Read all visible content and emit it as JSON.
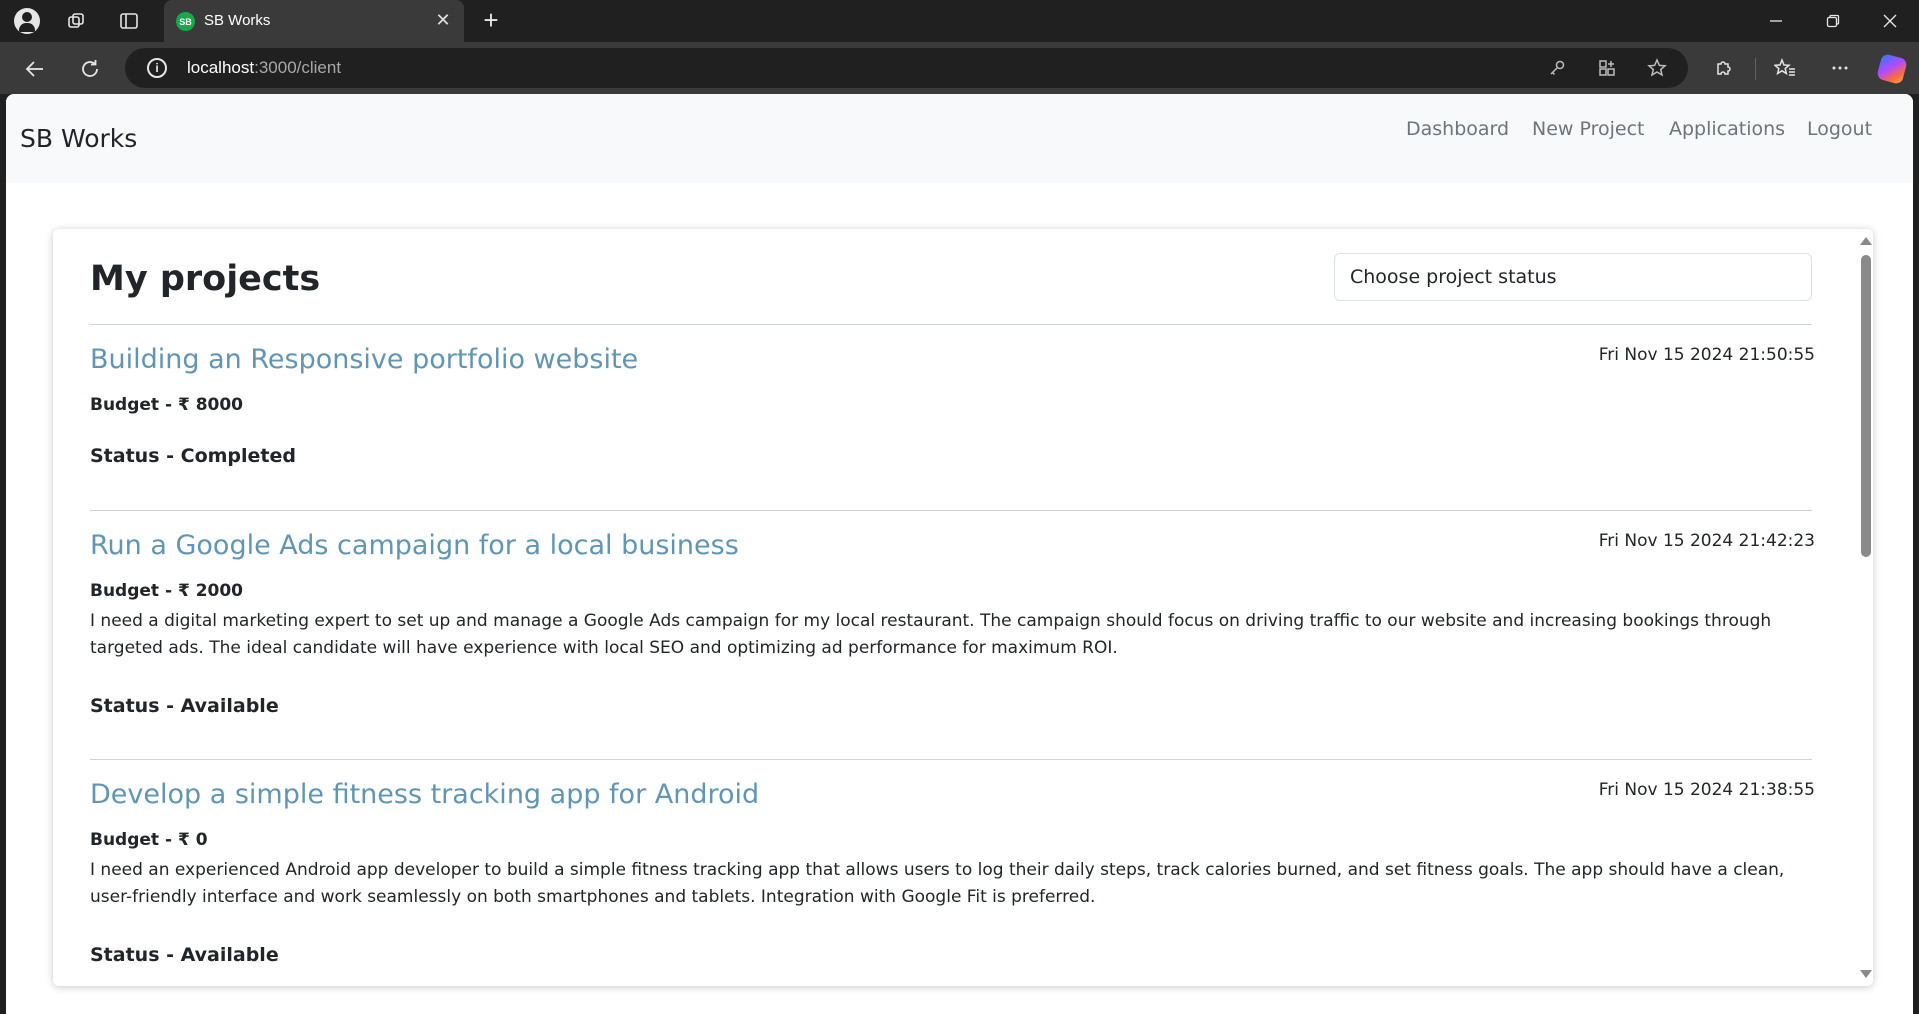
{
  "browser": {
    "tab_title": "SB Works",
    "tab_favicon_text": "SB",
    "url_host": "localhost",
    "url_path": ":3000/client",
    "icons": [
      "profile-icon",
      "workspaces-icon",
      "vertical-tabs-icon",
      "close-icon",
      "new-tab-icon",
      "minimize-icon",
      "maximize-icon",
      "window-close-icon",
      "back-icon",
      "refresh-icon",
      "site-info-icon",
      "password-key-icon",
      "app-available-icon",
      "favorite-star-icon",
      "extensions-icon",
      "favorites-icon",
      "more-icon",
      "copilot-icon"
    ]
  },
  "site": {
    "brand": "SB Works",
    "nav": {
      "dashboard": "Dashboard",
      "new_project": "New Project",
      "applications": "Applications",
      "logout": "Logout"
    }
  },
  "main": {
    "title": "My projects",
    "status_select_placeholder": "Choose project status",
    "projects": [
      {
        "title": "Building an Responsive portfolio website",
        "time": "Fri Nov 15 2024 21:50:55",
        "budget": "Budget - ₹ 8000",
        "description": "",
        "status": "Status - Completed"
      },
      {
        "title": "Run a Google Ads campaign for a local business",
        "time": "Fri Nov 15 2024 21:42:23",
        "budget": "Budget - ₹ 2000",
        "description": "I need a digital marketing expert to set up and manage a Google Ads campaign for my local restaurant. The campaign should focus on driving traffic to our website and increasing bookings through targeted ads. The ideal candidate will have experience with local SEO and optimizing ad performance for maximum ROI.",
        "status": "Status - Available"
      },
      {
        "title": "Develop a simple fitness tracking app for Android",
        "time": "Fri Nov 15 2024 21:38:55",
        "budget": "Budget - ₹ 0",
        "description": "I need an experienced Android app developer to build a simple fitness tracking app that allows users to log their daily steps, track calories burned, and set fitness goals. The app should have a clean, user-friendly interface and work seamlessly on both smartphones and tablets. Integration with Google Fit is preferred.",
        "status": "Status - Available"
      }
    ]
  },
  "colors": {
    "project_title": "#6096b4",
    "nav_bg": "#f8f9fa",
    "nav_link": "#6c757d"
  }
}
